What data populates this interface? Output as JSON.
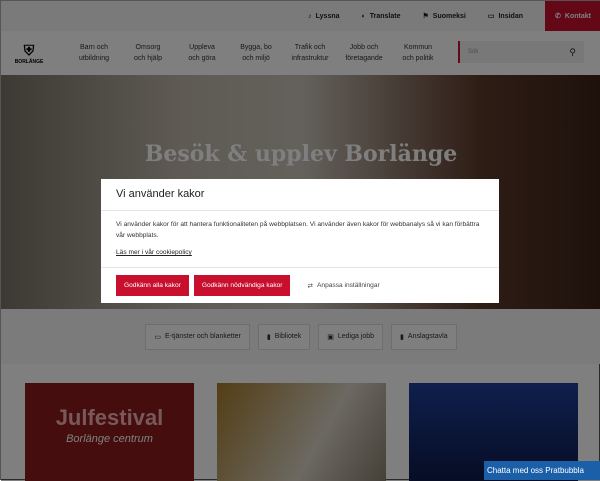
{
  "topbar": {
    "items": [
      {
        "icon": "ear-icon",
        "label": "Lyssna"
      },
      {
        "icon": "globe-icon",
        "label": "Translate"
      },
      {
        "icon": "flag-icon",
        "label": "Suomeksi"
      },
      {
        "icon": "monitor-icon",
        "label": "Insidan"
      }
    ],
    "contact": "Kontakt"
  },
  "logo": {
    "text": "BORLÄNGE"
  },
  "nav": [
    [
      "Barn och",
      "utbildning"
    ],
    [
      "Omsorg",
      "och hjälp"
    ],
    [
      "Uppleva",
      "och göra"
    ],
    [
      "Bygga, bo",
      "och miljö"
    ],
    [
      "Trafik och",
      "infrastruktur"
    ],
    [
      "Jobb och",
      "företagande"
    ],
    [
      "Kommun",
      "och politik"
    ]
  ],
  "search": {
    "placeholder": "Sök"
  },
  "hero": {
    "title": "Besök & upplev Borlänge"
  },
  "quicklinks": [
    "E-tjänster och blanketter",
    "Bibliotek",
    "Lediga jobb",
    "Anslagstavla"
  ],
  "cards": {
    "julfestival": "Julfestival",
    "centrum": "Borlänge centrum"
  },
  "modal": {
    "title": "Vi använder kakor",
    "body": "Vi använder kakor för att hantera funktionaliteten på webbplatsen. Vi använder även kakor för webbanalys så vi kan förbättra vår webbplats.",
    "link": "Läs mer i vår cookiepolicy",
    "accept_all": "Godkänn alla kakor",
    "accept_necessary": "Godkänn nödvändiga kakor",
    "settings": "Anpassa inställningar"
  },
  "chat": {
    "label": "Chatta med oss",
    "img_alt": "Pratbubbla"
  },
  "colors": {
    "accent": "#c8102e",
    "chat": "#1a5fa8"
  }
}
